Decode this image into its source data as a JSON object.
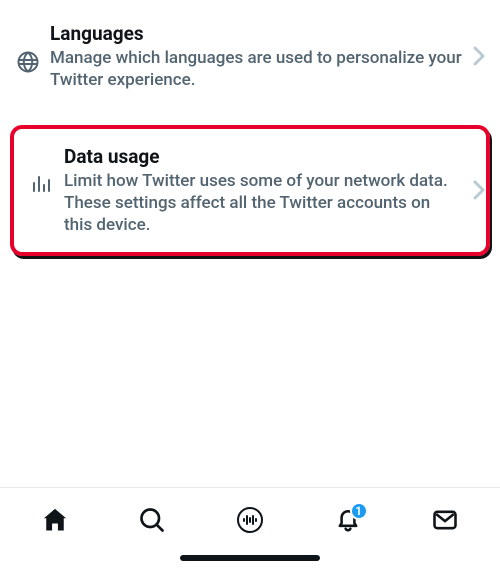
{
  "settings": {
    "languages": {
      "title": "Languages",
      "desc": "Manage which languages are used to personalize your Twitter experience."
    },
    "data_usage": {
      "title": "Data usage",
      "desc": "Limit how Twitter uses some of your network data. These settings affect all the Twitter accounts on this device."
    }
  },
  "nav": {
    "notifications_badge": "1"
  }
}
